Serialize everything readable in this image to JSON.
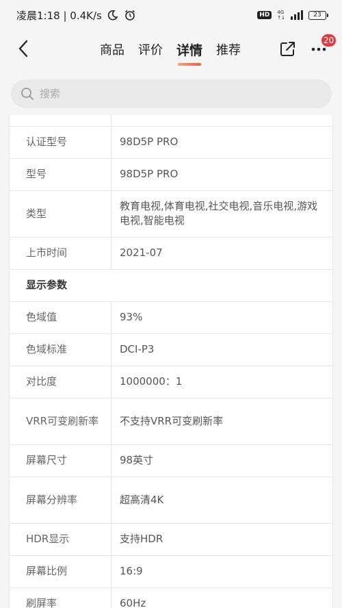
{
  "status_bar": {
    "time_speed": "凌晨1:18 | 0.4K/s",
    "hd": "HD",
    "net": "4G",
    "battery": "23"
  },
  "nav": {
    "tabs": [
      {
        "label": "商品"
      },
      {
        "label": "评价"
      },
      {
        "label": "详情"
      },
      {
        "label": "推荐"
      }
    ],
    "active_tab": "详情",
    "badge": "20",
    "accent_color": "#e75f3f",
    "icons": [
      "back-arrow-icon",
      "share-icon",
      "more-icon"
    ]
  },
  "search": {
    "placeholder": "搜索"
  },
  "specs": {
    "rows": [
      {
        "key": "",
        "value": ""
      },
      {
        "key": "认证型号",
        "value": "98D5P PRO"
      },
      {
        "key": "型号",
        "value": "98D5P PRO"
      },
      {
        "key": "类型",
        "value": "教育电视,体育电视,社交电视,音乐电视,游戏电视,智能电视"
      },
      {
        "key": "上市时间",
        "value": "2021-07"
      },
      {
        "section": "显示参数"
      },
      {
        "key": "色域值",
        "value": "93%"
      },
      {
        "key": "色域标准",
        "value": "DCI-P3"
      },
      {
        "key": "对比度",
        "value": "1000000：1"
      },
      {
        "key": "VRR可变刷新率",
        "value": "不支持VRR可变刷新率"
      },
      {
        "key": "屏幕尺寸",
        "value": "98英寸"
      },
      {
        "key": "屏幕分辨率",
        "value": "超高清4K"
      },
      {
        "key": "HDR显示",
        "value": "支持HDR"
      },
      {
        "key": "屏幕比例",
        "value": "16:9"
      },
      {
        "key": "刷屏率",
        "value": "60Hz"
      }
    ]
  }
}
